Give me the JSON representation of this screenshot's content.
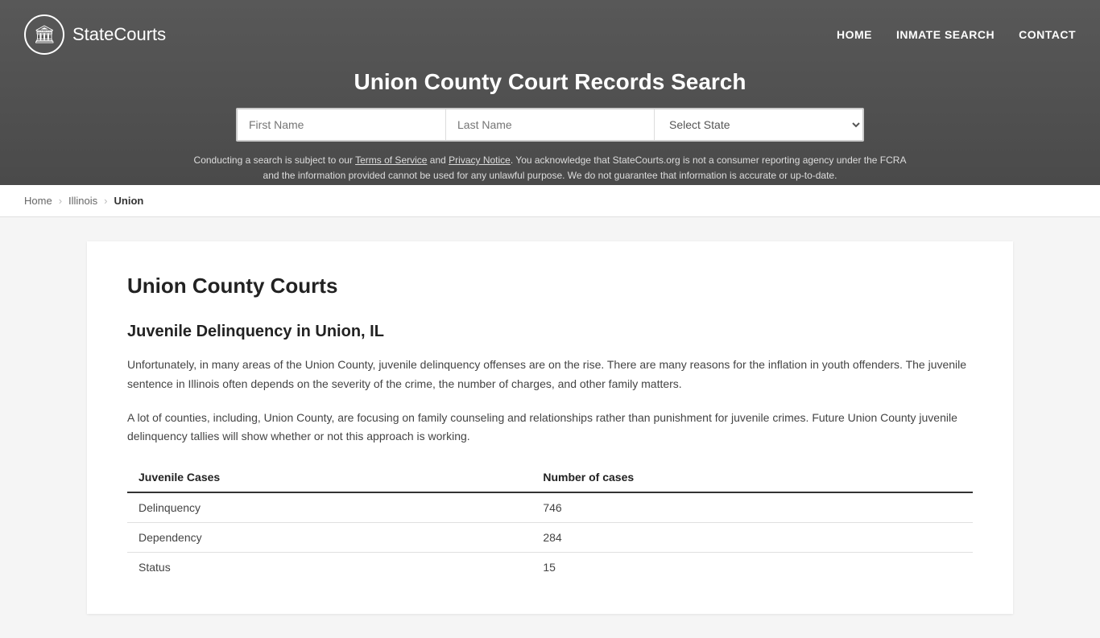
{
  "header": {
    "logo_text_bold": "State",
    "logo_text_normal": "Courts",
    "logo_icon": "🏛",
    "nav": {
      "home": "HOME",
      "inmate_search": "INMATE SEARCH",
      "contact": "CONTACT"
    },
    "page_title": "Union County Court Records Search",
    "search": {
      "first_name_placeholder": "First Name",
      "last_name_placeholder": "Last Name",
      "state_placeholder": "Select State"
    },
    "disclaimer": "Conducting a search is subject to our Terms of Service and Privacy Notice. You acknowledge that StateCourts.org is not a consumer reporting agency under the FCRA and the information provided cannot be used for any unlawful purpose. We do not guarantee that information is accurate or up-to-date.",
    "disclaimer_terms": "Terms of Service",
    "disclaimer_privacy": "Privacy Notice"
  },
  "breadcrumb": {
    "home": "Home",
    "state": "Illinois",
    "county": "Union"
  },
  "main": {
    "section_title": "Union County Courts",
    "subsection_title": "Juvenile Delinquency in Union, IL",
    "paragraph1": "Unfortunately, in many areas of the Union County, juvenile delinquency offenses are on the rise. There are many reasons for the inflation in youth offenders. The juvenile sentence in Illinois often depends on the severity of the crime, the number of charges, and other family matters.",
    "paragraph2": "A lot of counties, including, Union County, are focusing on family counseling and relationships rather than punishment for juvenile crimes. Future Union County juvenile delinquency tallies will show whether or not this approach is working.",
    "table": {
      "col1_header": "Juvenile Cases",
      "col2_header": "Number of cases",
      "rows": [
        {
          "case_type": "Delinquency",
          "count": "746"
        },
        {
          "case_type": "Dependency",
          "count": "284"
        },
        {
          "case_type": "Status",
          "count": "15"
        }
      ]
    }
  }
}
